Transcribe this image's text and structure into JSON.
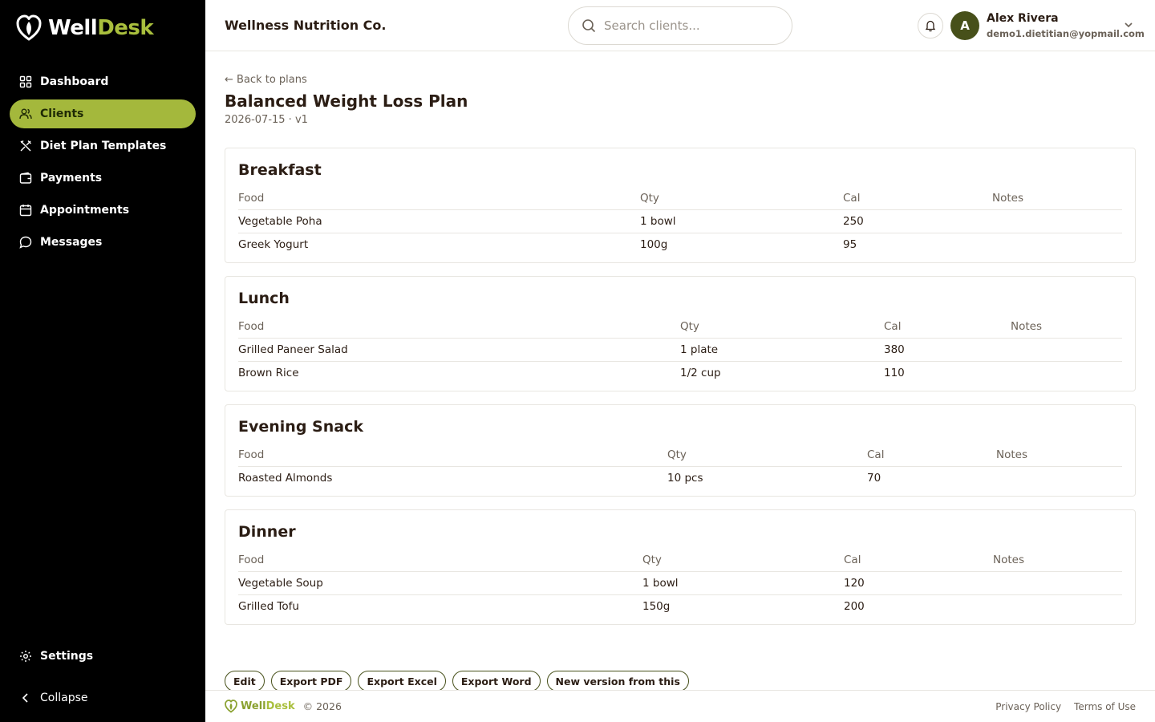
{
  "brand": {
    "name_part1": "Well",
    "name_part2": "Desk"
  },
  "sidebar": {
    "items": [
      {
        "label": "Dashboard",
        "icon": "grid-icon"
      },
      {
        "label": "Clients",
        "icon": "users-icon",
        "active": true
      },
      {
        "label": "Diet Plan Templates",
        "icon": "utensils-icon"
      },
      {
        "label": "Payments",
        "icon": "wallet-icon"
      },
      {
        "label": "Appointments",
        "icon": "calendar-icon"
      },
      {
        "label": "Messages",
        "icon": "chat-icon"
      }
    ],
    "settings_label": "Settings",
    "collapse_label": "Collapse"
  },
  "header": {
    "org_name": "Wellness Nutrition Co.",
    "search_placeholder": "Search clients...",
    "user": {
      "initial": "A",
      "name": "Alex Rivera",
      "email": "demo1.dietitian@yopmail.com"
    }
  },
  "plan": {
    "back_label": "← Back to plans",
    "title": "Balanced Weight Loss Plan",
    "meta": "2026-07-15 · v1",
    "columns": {
      "food": "Food",
      "qty": "Qty",
      "cal": "Cal",
      "notes": "Notes"
    },
    "meals": [
      {
        "title": "Breakfast",
        "rows": [
          {
            "food": "Vegetable Poha",
            "qty": "1 bowl",
            "cal": "250",
            "notes": ""
          },
          {
            "food": "Greek Yogurt",
            "qty": "100g",
            "cal": "95",
            "notes": ""
          }
        ]
      },
      {
        "title": "Lunch",
        "rows": [
          {
            "food": "Grilled Paneer Salad",
            "qty": "1 plate",
            "cal": "380",
            "notes": ""
          },
          {
            "food": "Brown Rice",
            "qty": "1/2 cup",
            "cal": "110",
            "notes": ""
          }
        ]
      },
      {
        "title": "Evening Snack",
        "rows": [
          {
            "food": "Roasted Almonds",
            "qty": "10 pcs",
            "cal": "70",
            "notes": ""
          }
        ]
      },
      {
        "title": "Dinner",
        "rows": [
          {
            "food": "Vegetable Soup",
            "qty": "1 bowl",
            "cal": "120",
            "notes": ""
          },
          {
            "food": "Grilled Tofu",
            "qty": "150g",
            "cal": "200",
            "notes": ""
          }
        ]
      }
    ],
    "actions": {
      "edit": "Edit",
      "export_pdf": "Export PDF",
      "export_excel": "Export Excel",
      "export_word": "Export Word",
      "new_version": "New version from this"
    }
  },
  "footer": {
    "copyright": "© 2026",
    "privacy": "Privacy Policy",
    "terms": "Terms of Use"
  },
  "colors": {
    "accent": "#a4b83c",
    "avatar": "#47501a",
    "sidebar_bg": "#000000",
    "text": "#2b1d14"
  }
}
